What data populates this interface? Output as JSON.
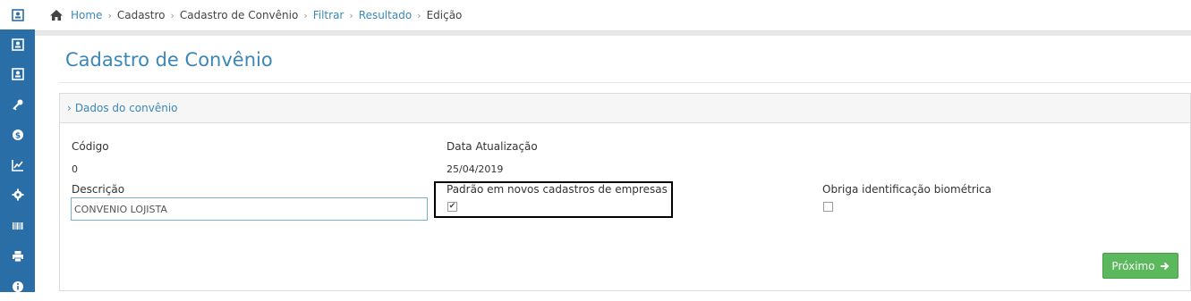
{
  "sidebar": {
    "items": [
      {
        "icon": "contact-card-icon"
      },
      {
        "icon": "contact-card-icon"
      },
      {
        "icon": "contact-card-icon"
      },
      {
        "icon": "key-icon"
      },
      {
        "icon": "dollar-icon"
      },
      {
        "icon": "chart-icon"
      },
      {
        "icon": "gear-icon"
      },
      {
        "icon": "barcode-icon"
      },
      {
        "icon": "printer-icon"
      },
      {
        "icon": "info-icon"
      }
    ]
  },
  "breadcrumb": {
    "home": "Home",
    "cadastro": "Cadastro",
    "cadastro_convenio": "Cadastro de Convênio",
    "filtrar": "Filtrar",
    "resultado": "Resultado",
    "edicao": "Edição"
  },
  "page": {
    "title": "Cadastro de Convênio"
  },
  "panel": {
    "header": "Dados do convênio"
  },
  "form": {
    "codigo_label": "Código",
    "codigo_value": "0",
    "data_label": "Data Atualização",
    "data_value": "25/04/2019",
    "descricao_label": "Descrição",
    "descricao_value": "CONVENIO LOJISTA",
    "padrao_label": "Padrão em novos cadastros de empresas",
    "padrao_checked": true,
    "biometria_label": "Obriga identificação biométrica",
    "biometria_checked": false
  },
  "actions": {
    "next_label": "Próximo"
  },
  "colors": {
    "sidebar": "#2a6ea8",
    "link": "#3a87b8",
    "success": "#5cb85c"
  }
}
